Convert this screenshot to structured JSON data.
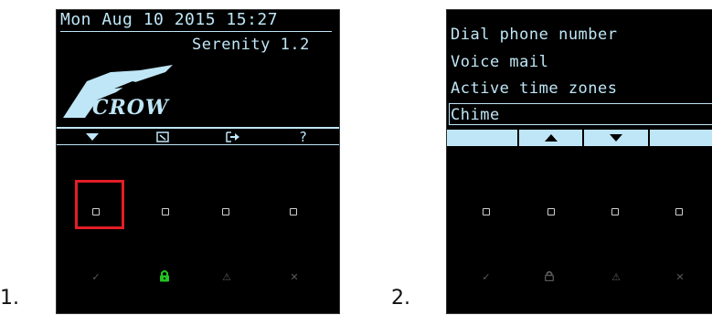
{
  "steps": [
    "1.",
    "2."
  ],
  "screen1": {
    "datetime": "Mon Aug 10 2015 15:27",
    "model": "Serenity 1.2",
    "logo_text": "CROW",
    "softkeys": [
      "down-arrow-icon",
      "menu-square-icon",
      "exit-icon",
      "help-question-icon"
    ],
    "help_label": "?"
  },
  "screen2": {
    "menu": [
      "Dial phone number",
      "Voice mail",
      "Active time zones",
      "Chime"
    ],
    "selected": "Chime",
    "softkeys": [
      "blank",
      "up-arrow-icon",
      "down-arrow-icon",
      "blank"
    ]
  },
  "status_icons": [
    "check-icon",
    "lock-icon",
    "warning-icon",
    "close-icon"
  ],
  "colors": {
    "lcd_text": "#bfe6f6",
    "highlight": "#e31e24",
    "armed_lock": "#22c322",
    "status_dim": "#5a5a5a"
  }
}
